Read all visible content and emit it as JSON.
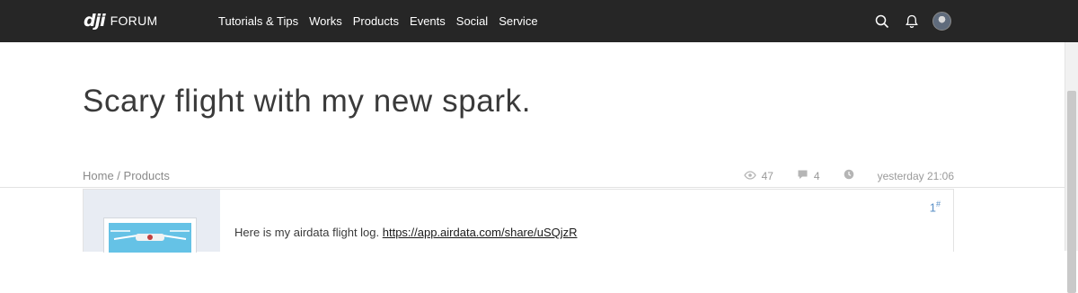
{
  "header": {
    "logo_mark": "dji",
    "logo_text": "FORUM",
    "nav": [
      "Tutorials & Tips",
      "Works",
      "Products",
      "Events",
      "Social",
      "Service"
    ],
    "icons": [
      "search-icon",
      "bell-icon",
      "avatar"
    ]
  },
  "thread": {
    "title": "Scary flight with my new spark.",
    "breadcrumb": {
      "home": "Home",
      "separator": " / ",
      "section": "Products"
    },
    "views": "47",
    "replies": "4",
    "time": "yesterday 21:06"
  },
  "post": {
    "floor_number": "1",
    "floor_suffix": "#",
    "text": "Here is my airdata flight log. ",
    "link_text": "https://app.airdata.com/share/uSQjzR"
  },
  "colors": {
    "topbar": "#262626",
    "sidebar_bg": "#e8ecf3",
    "accent": "#5a8fc6"
  }
}
